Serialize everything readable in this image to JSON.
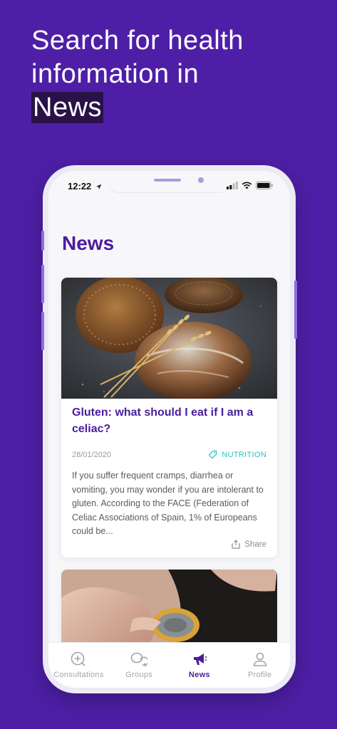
{
  "headline": {
    "line1": "Search for health",
    "line2": "information in",
    "highlight": "News"
  },
  "status_bar": {
    "time": "12:22"
  },
  "page": {
    "title": "News"
  },
  "articles": [
    {
      "title": "Gluten: what should I eat if I am a celiac?",
      "date": "28/01/2020",
      "tag": "NUTRITION",
      "excerpt": "If you suffer frequent cramps, diarrhea or vomiting, you may wonder if you are intolerant to gluten. According to the FACE (Federation of Celiac Associations of Spain, 1% of Europeans could be...",
      "share_label": "Share"
    }
  ],
  "tabbar": {
    "items": [
      {
        "label": "Consultations",
        "icon": "plus-circle-icon",
        "active": false
      },
      {
        "label": "Groups",
        "icon": "chat-bubbles-icon",
        "active": false
      },
      {
        "label": "News",
        "icon": "megaphone-icon",
        "active": true
      },
      {
        "label": "Profile",
        "icon": "person-icon",
        "active": false
      }
    ]
  },
  "colors": {
    "background": "#4e1fa6",
    "accent": "#4b1c9c",
    "tag": "#2ac2c0",
    "highlight_bg": "#2a1248"
  }
}
